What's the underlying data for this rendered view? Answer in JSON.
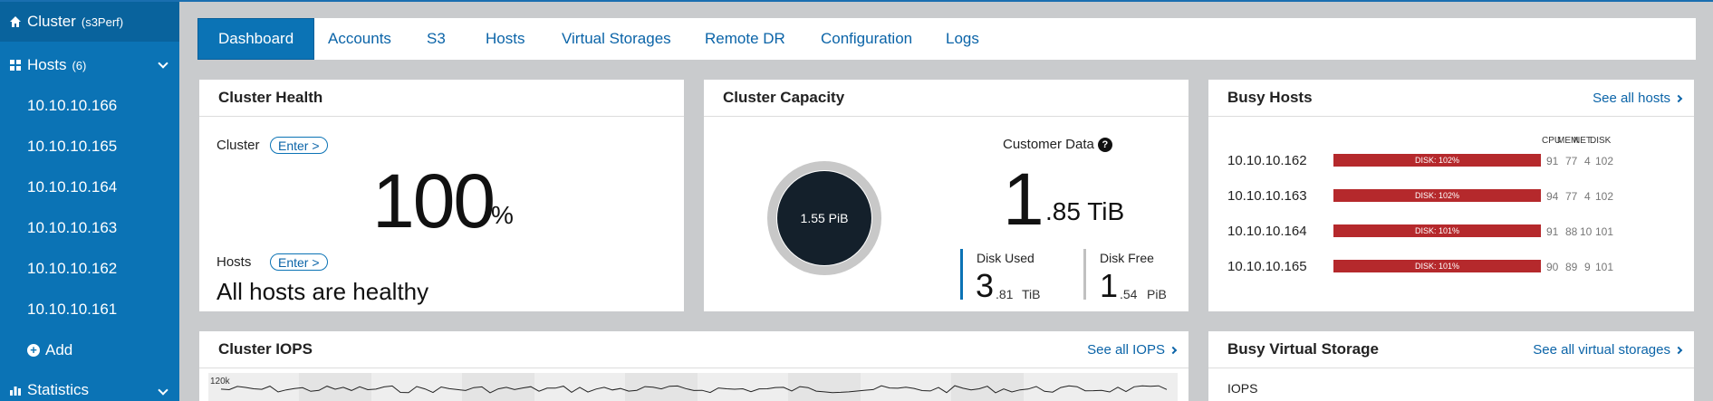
{
  "sidebar": {
    "cluster": {
      "label": "Cluster",
      "name": "(s3Perf)"
    },
    "hosts": {
      "label": "Hosts",
      "count": "(6)"
    },
    "host_items": [
      "10.10.10.166",
      "10.10.10.165",
      "10.10.10.164",
      "10.10.10.163",
      "10.10.10.162",
      "10.10.10.161"
    ],
    "add_label": "Add",
    "statistics_label": "Statistics"
  },
  "tabs": [
    "Dashboard",
    "Accounts",
    "S3",
    "Hosts",
    "Virtual Storages",
    "Remote DR",
    "Configuration",
    "Logs"
  ],
  "active_tab": "Dashboard",
  "cluster_health": {
    "title": "Cluster Health",
    "cluster_label": "Cluster",
    "enter_label": "Enter >",
    "health_value": "100",
    "health_unit": "%",
    "hosts_label": "Hosts",
    "hosts_status": "All hosts are healthy"
  },
  "cluster_capacity": {
    "title": "Cluster Capacity",
    "donut_label": "1.55 PiB",
    "customer_data_label": "Customer Data",
    "customer_data_int": "1",
    "customer_data_dec": ".85 TiB",
    "disk_used_label": "Disk Used",
    "disk_used_int": "3",
    "disk_used_dec": ".81",
    "disk_used_unit": "TiB",
    "disk_free_label": "Disk Free",
    "disk_free_int": "1",
    "disk_free_dec": ".54",
    "disk_free_unit": "PiB",
    "colors": {
      "donut_ring": "#c8c8c8",
      "donut_center": "#14202b",
      "used_bar": "#0b73b5",
      "free_bar": "#c0c0c0"
    }
  },
  "busy_hosts": {
    "title": "Busy Hosts",
    "see_all": "See all hosts",
    "columns": [
      "CPU",
      "MEM",
      "NET",
      "DISK"
    ],
    "rows": [
      {
        "ip": "10.10.10.162",
        "bar": "DISK: 102%",
        "cpu": "91",
        "mem": "77",
        "net": "4",
        "disk": "102"
      },
      {
        "ip": "10.10.10.163",
        "bar": "DISK: 102%",
        "cpu": "94",
        "mem": "77",
        "net": "4",
        "disk": "102"
      },
      {
        "ip": "10.10.10.164",
        "bar": "DISK: 101%",
        "cpu": "91",
        "mem": "88",
        "net": "10",
        "disk": "101"
      },
      {
        "ip": "10.10.10.165",
        "bar": "DISK: 101%",
        "cpu": "90",
        "mem": "89",
        "net": "9",
        "disk": "101"
      }
    ],
    "bar_color": "#b5292c"
  },
  "cluster_iops": {
    "title": "Cluster IOPS",
    "see_all": "See all IOPS",
    "y_tick": "120k"
  },
  "busy_virtual_storage": {
    "title": "Busy Virtual Storage",
    "see_all": "See all virtual storages",
    "iops_label": "IOPS"
  }
}
